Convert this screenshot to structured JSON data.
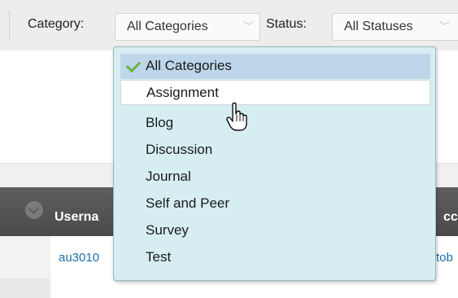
{
  "filters": {
    "category_label": "Category:",
    "category_value": "All Categories",
    "status_label": "Status:",
    "status_value": "All Statuses"
  },
  "dropdown": {
    "options": [
      {
        "label": "All Categories",
        "selected": true
      },
      {
        "label": "Assignment",
        "hovered": true
      },
      {
        "label": "Blog"
      },
      {
        "label": "Discussion"
      },
      {
        "label": "Journal"
      },
      {
        "label": "Self and Peer"
      },
      {
        "label": "Survey"
      },
      {
        "label": "Test"
      }
    ]
  },
  "table": {
    "header": {
      "col_username": "Userna",
      "col_right": "cc"
    },
    "rows": [
      {
        "username": "au3010",
        "right_text": "tob"
      }
    ]
  },
  "icons": {
    "chevron": "double-chevron-down-icon",
    "check": "check-icon",
    "cursor": "hand-pointer-cursor-icon",
    "sort": "sort-circle-icon"
  },
  "colors": {
    "dropdown_bg": "#d6eef1",
    "selected_bg": "#bdd6ea",
    "hover_bg": "#ffffff",
    "check": "#6cb33f",
    "link": "#1f6fa8",
    "header_bg": "#555555"
  }
}
